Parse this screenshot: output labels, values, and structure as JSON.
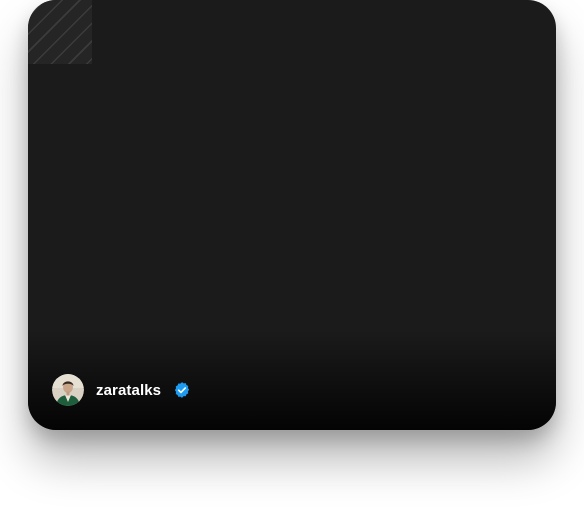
{
  "profile": {
    "username": "zaratalks",
    "verified": true,
    "avatar_icon": "avatar-photo",
    "badge_icon": "verified-badge-icon",
    "badge_color": "#1d9bf0"
  },
  "card": {
    "background_color": "#1b1b1b"
  }
}
